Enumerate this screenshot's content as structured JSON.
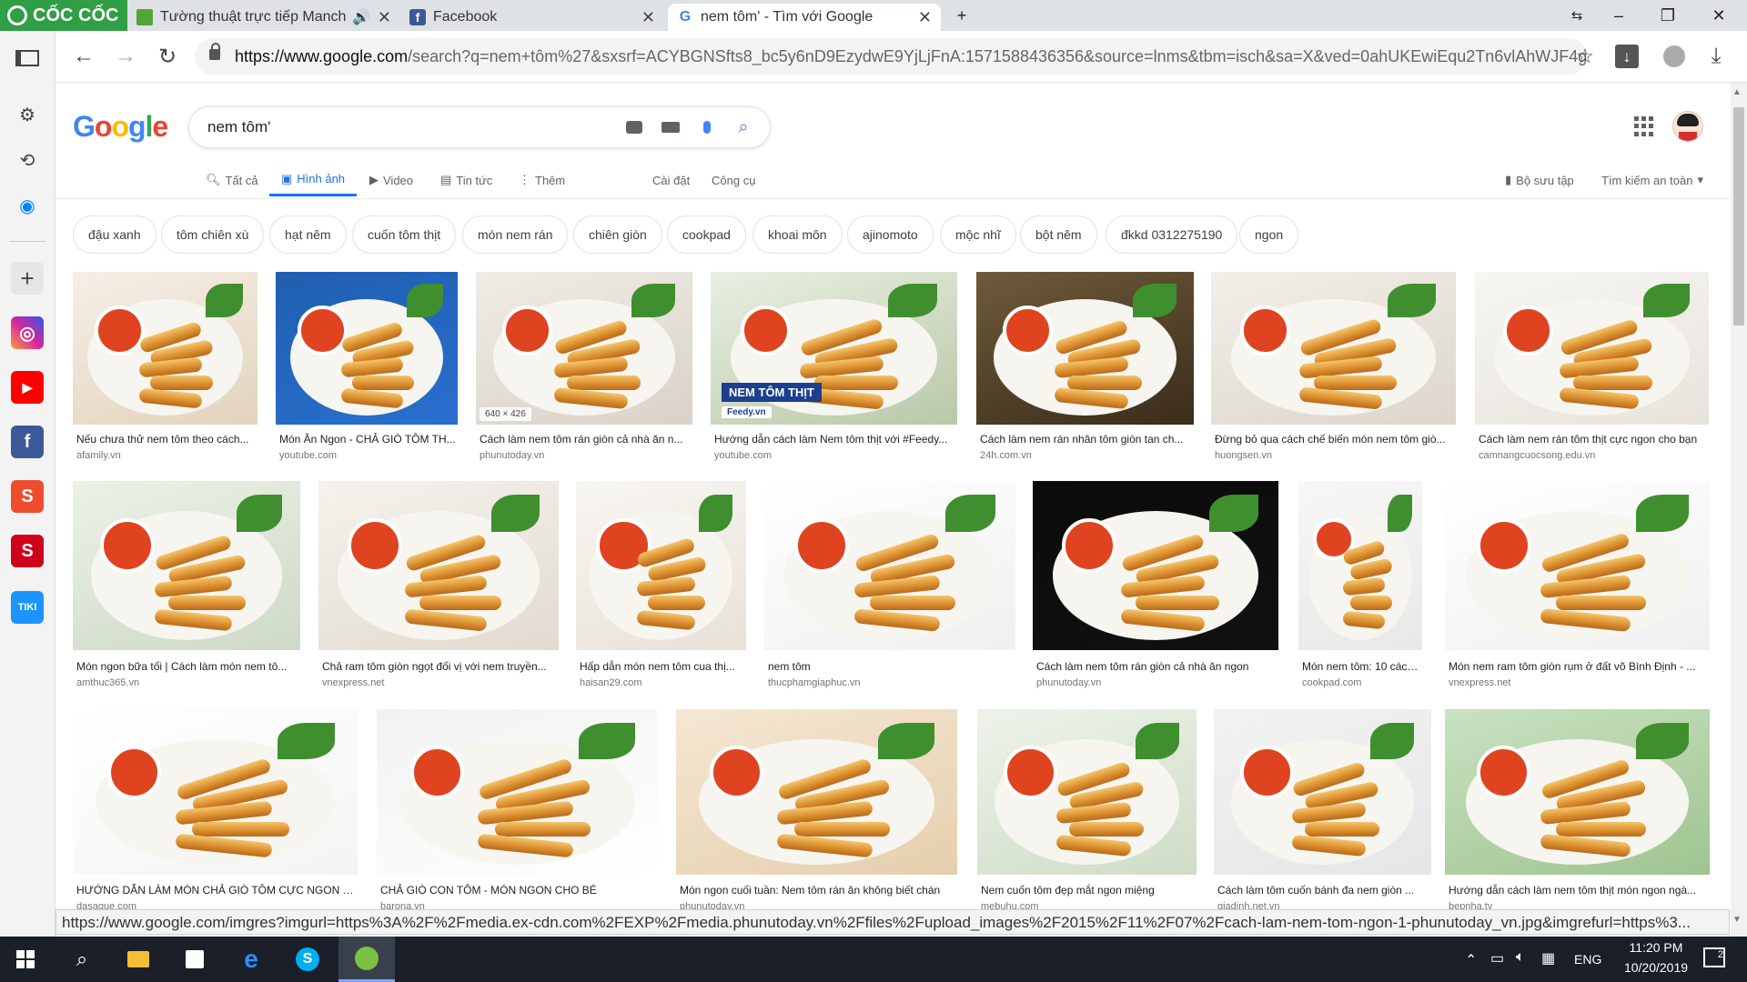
{
  "browser": {
    "brand": "CỐC CỐC",
    "tabs": [
      {
        "title": "Tường thuật trực tiếp Manche"
      },
      {
        "title": "Facebook"
      },
      {
        "title": "nem tôm' - Tìm với Google"
      }
    ],
    "url_host": "https://www.google.com",
    "url_rest": "/search?q=nem+tôm%27&sxsrf=ACYBGNSfts8_bc5y6nD9EzydwE9YjLjFnA:1571588436356&source=lnms&tbm=isch&sa=X&ved=0ahUKEwiEqu2Tn6vlAhWJF4gKH..."
  },
  "google": {
    "logo": [
      {
        "ch": "G",
        "color": "#4285f4"
      },
      {
        "ch": "o",
        "color": "#ea4335"
      },
      {
        "ch": "o",
        "color": "#fbbc05"
      },
      {
        "ch": "g",
        "color": "#4285f4"
      },
      {
        "ch": "l",
        "color": "#34a853"
      },
      {
        "ch": "e",
        "color": "#ea4335"
      }
    ],
    "query": "nem tôm'",
    "nav": {
      "all": "Tất cả",
      "images": "Hình ảnh",
      "video": "Video",
      "news": "Tin tức",
      "more": "Thêm",
      "settings": "Cài đặt",
      "tools": "Công cụ",
      "collections": "Bộ sưu tập",
      "safe_search": "Tìm kiếm an toàn"
    },
    "chips": [
      "đậu xanh",
      "tôm chiên xù",
      "hạt nêm",
      "cuốn tôm thịt",
      "món nem rán",
      "chiên giòn",
      "cookpad",
      "khoai môn",
      "ajinomoto",
      "mộc nhĩ",
      "bột nêm",
      "đkkd 0312275190",
      "ngon"
    ],
    "hover_size": "640 × 426",
    "overlay_text": "NEM TÔM THỊT",
    "overlay_brand": "Feedy.vn",
    "results": [
      {
        "caption": "Nếu chưa thử nem tôm theo cách...",
        "source": "afamily.vn"
      },
      {
        "caption": "Món Ăn Ngon - CHẢ GIÒ TÔM TH...",
        "source": "youtube.com"
      },
      {
        "caption": "Cách làm nem tôm rán giòn cả nhà ăn n...",
        "source": "phunutoday.vn"
      },
      {
        "caption": "Hướng dẫn cách làm Nem tôm thịt với #Feedy...",
        "source": "youtube.com"
      },
      {
        "caption": "Cách làm nem rán nhân tôm giòn tan ch...",
        "source": "24h.com.vn"
      },
      {
        "caption": "Đừng bỏ qua cách chế biến món nem tôm giò...",
        "source": "huongsen.vn"
      },
      {
        "caption": "Cách làm nem rán tôm thịt cực ngon cho bạn",
        "source": "camnangcuocsong.edu.vn"
      },
      {
        "caption": "Món ngon bữa tối | Cách làm món nem tô...",
        "source": "amthuc365.vn"
      },
      {
        "caption": "Chả ram tôm giòn ngọt đối vị với nem truyền...",
        "source": "vnexpress.net"
      },
      {
        "caption": "Hấp dẫn món nem tôm cua thị...",
        "source": "haisan29.com"
      },
      {
        "caption": "nem tôm",
        "source": "thucphamgiaphuc.vn"
      },
      {
        "caption": "Cách làm nem tôm rán giòn cả nhà ăn ngon",
        "source": "phunutoday.vn"
      },
      {
        "caption": "Món nem tôm: 10 cách...",
        "source": "cookpad.com"
      },
      {
        "caption": "Món nem ram tôm giòn rụm ở đất võ Bình Định - ...",
        "source": "vnexpress.net"
      },
      {
        "caption": "HƯỚNG DẪN LÀM MÓN CHẢ GIÒ TÔM CỰC NGON (C...",
        "source": "dasague.com"
      },
      {
        "caption": "CHẢ GIÒ CON TÔM - MÓN NGON CHO BÉ",
        "source": "barona.vn"
      },
      {
        "caption": "Món ngon cuối tuần: Nem tôm rán ăn không biết chán",
        "source": "phunutoday.vn"
      },
      {
        "caption": "Nem cuốn tôm đẹp mắt ngon miệng",
        "source": "mebuhu.com"
      },
      {
        "caption": "Cách làm tôm cuốn bánh đa nem giòn ...",
        "source": "giadinh.net.vn"
      },
      {
        "caption": "Hướng dẫn cách làm nem tôm thịt món ngon ngà...",
        "source": "bepnha.tv"
      }
    ]
  },
  "statusbar": "https://www.google.com/imgres?imgurl=https%3A%2F%2Fmedia.ex-cdn.com%2FEXP%2Fmedia.phunutoday.vn%2Ffiles%2Fupload_images%2F2015%2F11%2F07%2Fcach-lam-nem-tom-ngon-1-phunutoday_vn.jpg&imgrefurl=https%3...",
  "taskbar": {
    "time": "11:20 PM",
    "date": "10/20/2019",
    "lang": "ENG",
    "notif": "2"
  },
  "sidebar_badges": {
    "tiki": "TIKI"
  }
}
